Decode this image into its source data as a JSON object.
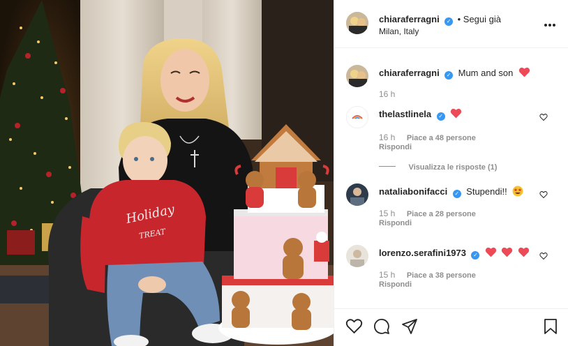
{
  "header": {
    "username": "chiaraferragni",
    "follow_status": "• Segui già",
    "location": "Milan, Italy"
  },
  "caption": {
    "username": "chiaraferragni",
    "text": "Mum and son",
    "time": "16 h"
  },
  "comments": [
    {
      "username": "thelastlinela",
      "text": "",
      "time": "16 h",
      "likes": "Piace a 48 persone",
      "reply": "Rispondi",
      "view_replies": "Visualizza le risposte (1)"
    },
    {
      "username": "nataliabonifacci",
      "text": "Stupendi!!",
      "time": "15 h",
      "likes": "Piace a 28 persone",
      "reply": "Rispondi"
    },
    {
      "username": "lorenzo.serafini1973",
      "text": "",
      "time": "15 h",
      "likes": "Piace a 38 persone",
      "reply": "Rispondi"
    }
  ],
  "colors": {
    "verified": "#3897f0",
    "heart": "#ed4956"
  }
}
